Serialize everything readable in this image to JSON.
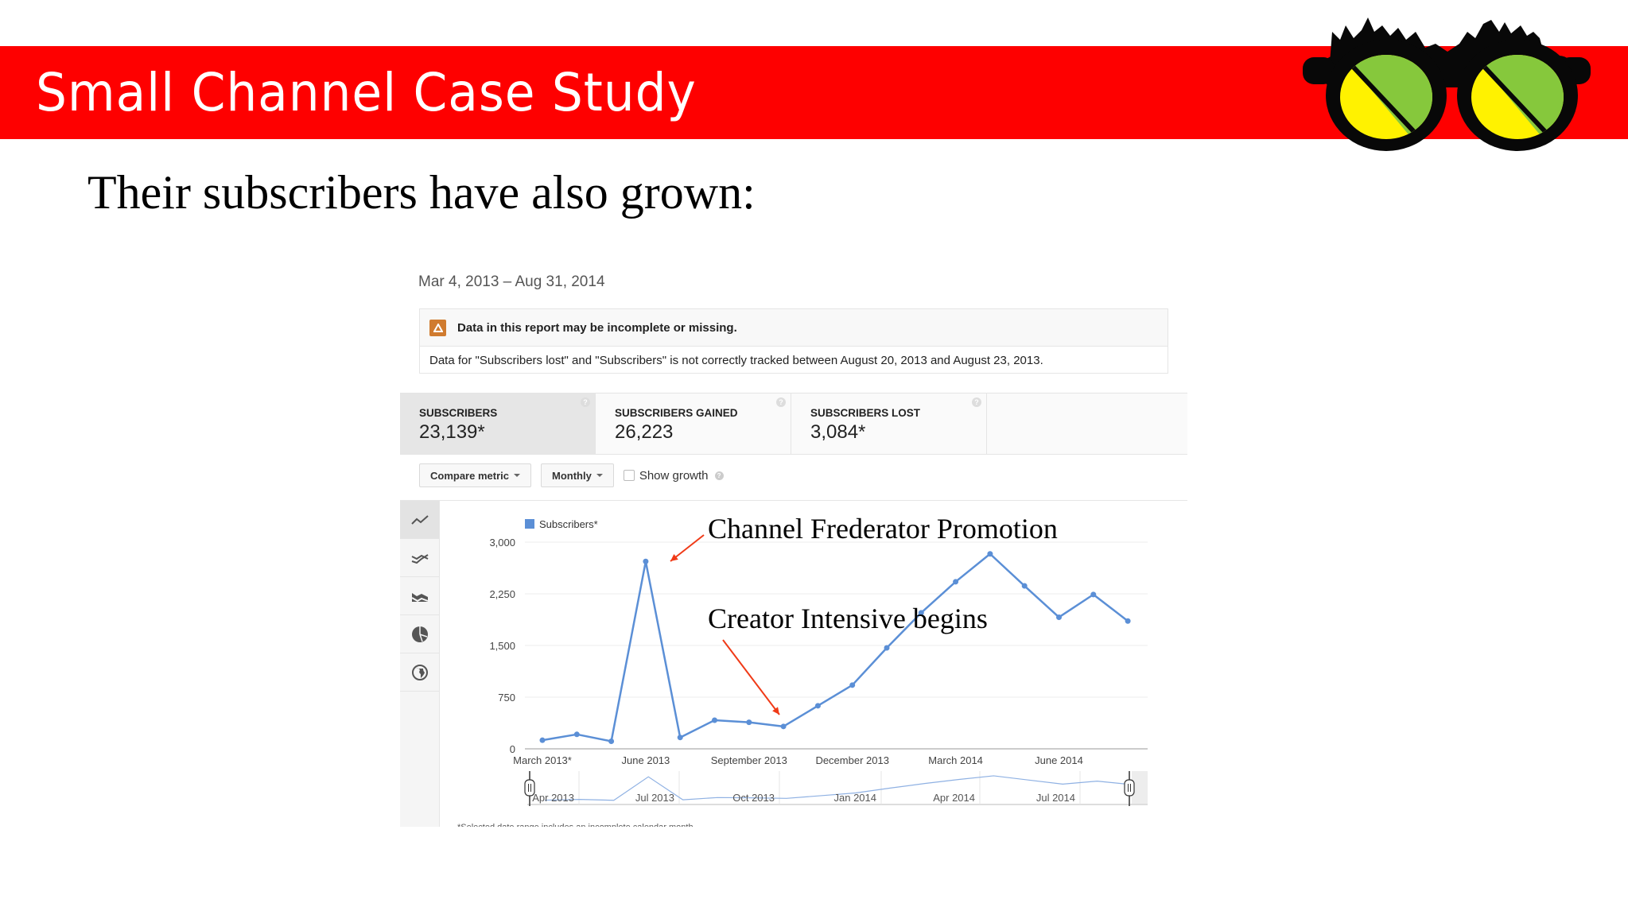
{
  "slide": {
    "title": "Small Channel Case Study",
    "subtitle": "Their subscribers have also grown:",
    "logo": "glasses-logo",
    "colors": {
      "band": "#fe0000",
      "lens_green": "#86c83c",
      "lens_yellow": "#fff200"
    }
  },
  "report": {
    "date_range": "Mar 4, 2013 – Aug 31, 2014",
    "warning": {
      "icon": "warning-triangle-icon",
      "title": "Data in this report may be incomplete or missing.",
      "body": "Data for \"Subscribers lost\" and \"Subscribers\" is not correctly tracked between August 20, 2013 and August 23, 2013."
    },
    "metrics": [
      {
        "label": "SUBSCRIBERS",
        "value": "23,139*",
        "active": true
      },
      {
        "label": "SUBSCRIBERS GAINED",
        "value": "26,223",
        "active": false
      },
      {
        "label": "SUBSCRIBERS LOST",
        "value": "3,084*",
        "active": false
      }
    ],
    "controls": {
      "compare_metric": "Compare metric",
      "interval": "Monthly",
      "show_growth": "Show growth",
      "show_growth_checked": false
    },
    "chart_types": [
      "line-chart-icon",
      "multi-line-chart-icon",
      "stacked-area-icon",
      "pie-chart-icon",
      "globe-map-icon"
    ],
    "footnote": "*Selected date range includes an incomplete calendar month"
  },
  "chart_data": {
    "type": "line",
    "title": "",
    "xlabel": "",
    "ylabel": "",
    "legend": {
      "entries": [
        "Subscribers*"
      ],
      "placement": "top-left"
    },
    "series_color": "#5b8fd6",
    "grid": true,
    "ylim": [
      0,
      3000
    ],
    "yticks": [
      0,
      750,
      1500,
      2250,
      3000
    ],
    "ytick_labels": [
      "0",
      "750",
      "1,500",
      "2,250",
      "3,000"
    ],
    "x": [
      "Mar 2013",
      "Apr 2013",
      "May 2013",
      "Jun 2013",
      "Jul 2013",
      "Aug 2013",
      "Sep 2013",
      "Oct 2013",
      "Nov 2013",
      "Dec 2013",
      "Jan 2014",
      "Feb 2014",
      "Mar 2014",
      "Apr 2014",
      "May 2014",
      "Jun 2014",
      "Jul 2014",
      "Aug 2014"
    ],
    "xtick_labels": [
      {
        "index": 0,
        "label": "March 2013*"
      },
      {
        "index": 3,
        "label": "June 2013"
      },
      {
        "index": 6,
        "label": "September 2013"
      },
      {
        "index": 9,
        "label": "December 2013"
      },
      {
        "index": 12,
        "label": "March 2014"
      },
      {
        "index": 15,
        "label": "June 2014"
      }
    ],
    "series": [
      {
        "name": "Subscribers*",
        "values": [
          125,
          210,
          110,
          2720,
          165,
          415,
          385,
          325,
          625,
          925,
          1465,
          1975,
          2425,
          2830,
          2365,
          1910,
          2240,
          1855
        ]
      }
    ],
    "navigator_labels": [
      {
        "index": 1,
        "label": "Apr 2013"
      },
      {
        "index": 4,
        "label": "Jul 2013"
      },
      {
        "index": 7,
        "label": "Oct 2013"
      },
      {
        "index": 10,
        "label": "Jan 2014"
      },
      {
        "index": 13,
        "label": "Apr 2014"
      },
      {
        "index": 16,
        "label": "Jul 2014"
      }
    ],
    "annotations": [
      {
        "text": "Channel Frederator Promotion",
        "points_to_index": 3,
        "arrow_color": "#f03a17"
      },
      {
        "text": "Creator Intensive begins",
        "points_to_index": 7,
        "arrow_color": "#f03a17"
      }
    ]
  }
}
